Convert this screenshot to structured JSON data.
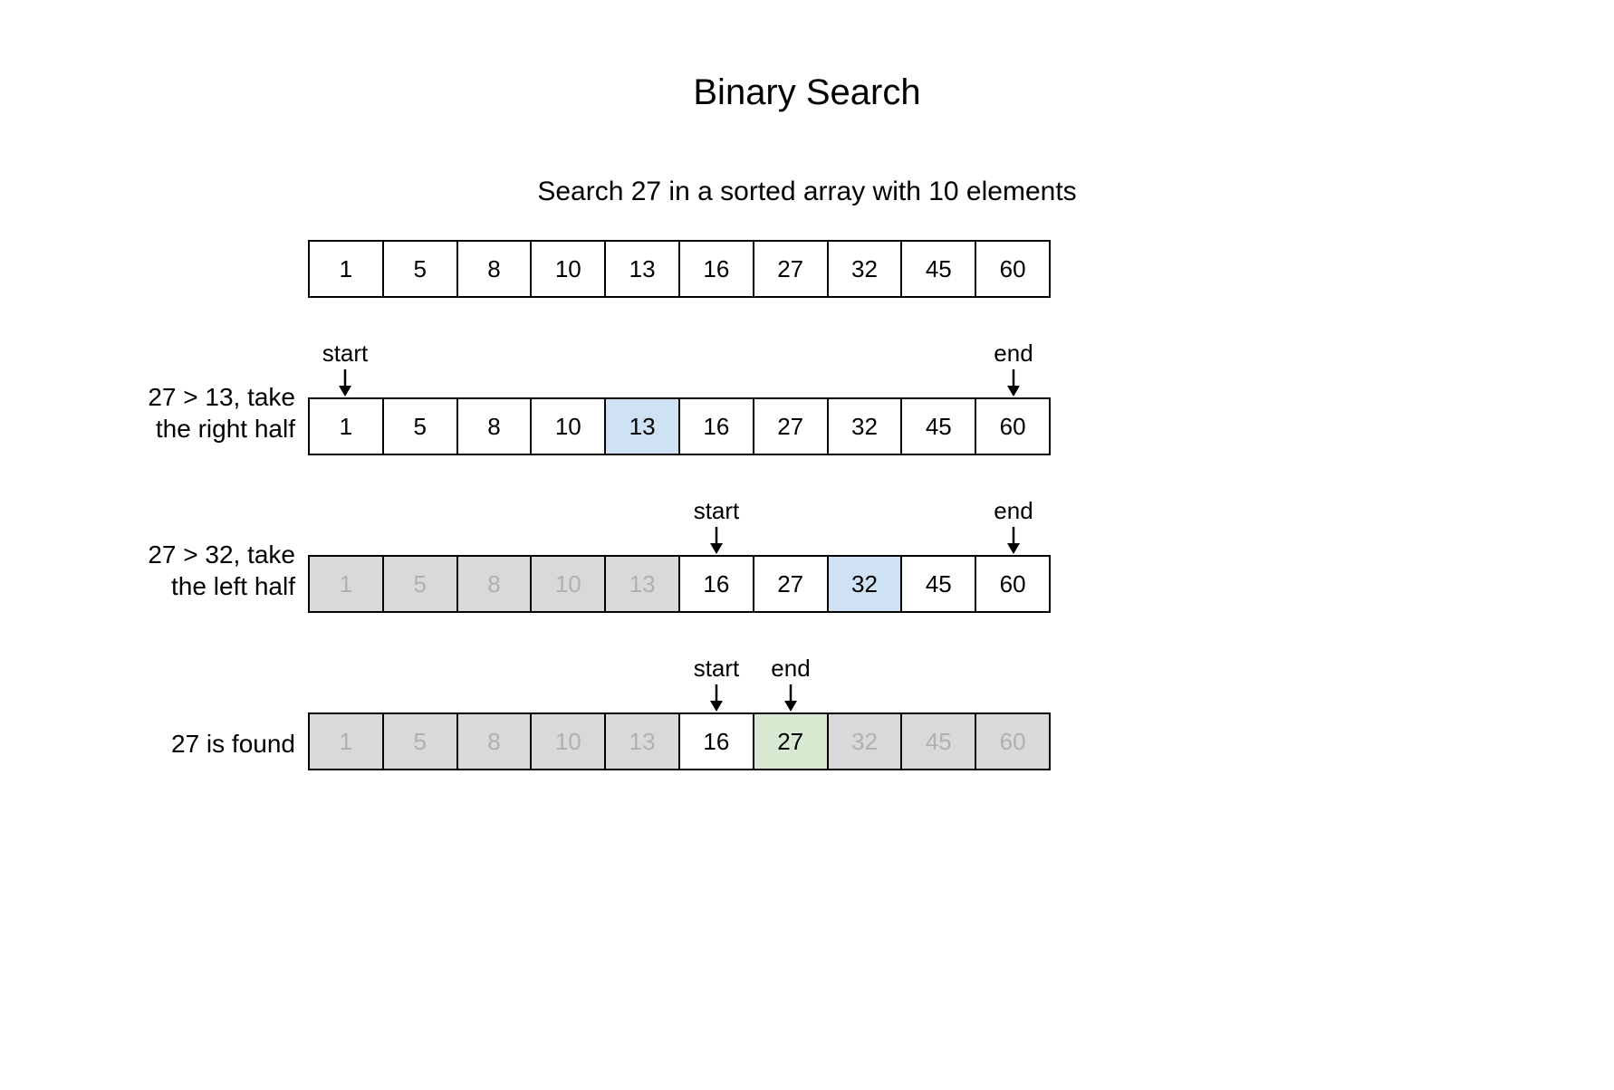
{
  "title": "Binary Search",
  "subtitle": "Search 27 in a sorted array with 10 elements",
  "array": [
    "1",
    "5",
    "8",
    "10",
    "13",
    "16",
    "27",
    "32",
    "45",
    "60"
  ],
  "pointer_labels": {
    "start": "start",
    "end": "end"
  },
  "steps": [
    {
      "caption_line1": "27 > 13, take",
      "caption_line2": "the right half",
      "start_index": 0,
      "end_index": 9,
      "mid_index": 4,
      "mid_class": "mid-blue",
      "dim_before": -1,
      "dim_after": 10
    },
    {
      "caption_line1": "27 > 32, take",
      "caption_line2": "the left half",
      "start_index": 5,
      "end_index": 9,
      "mid_index": 7,
      "mid_class": "mid-blue",
      "dim_before": 5,
      "dim_after": 10
    },
    {
      "caption_line1": "27 is found",
      "caption_line2": "",
      "start_index": 5,
      "end_index": 6,
      "mid_index": 6,
      "mid_class": "found-green",
      "dim_before": 5,
      "dim_after": 6
    }
  ]
}
